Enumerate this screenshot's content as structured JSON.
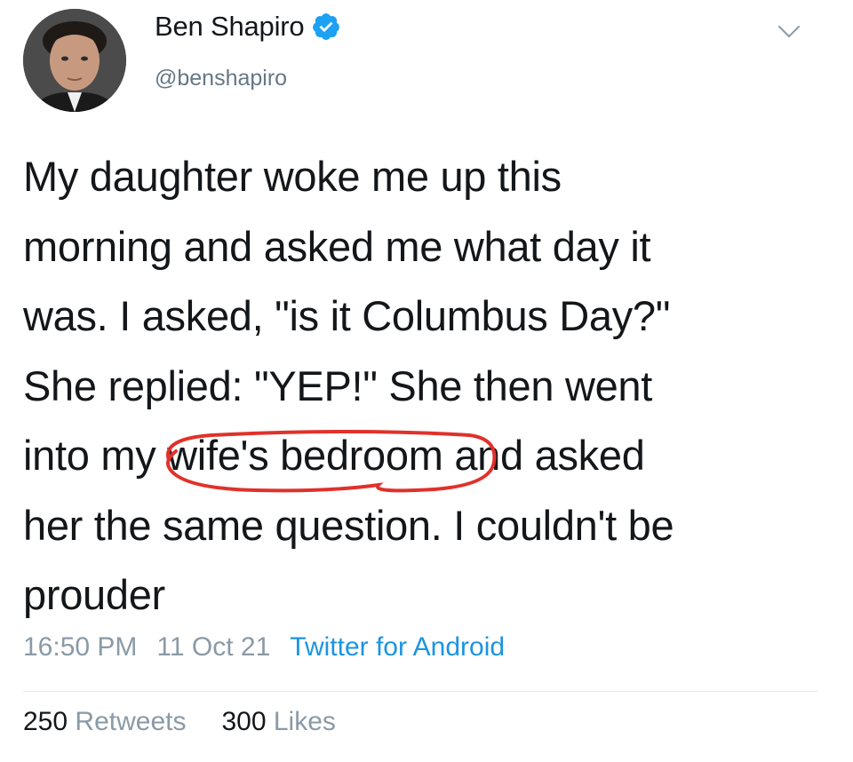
{
  "author": {
    "display_name": "Ben Shapiro",
    "handle": "@benshapiro",
    "verified": true
  },
  "tweet": {
    "lines": [
      "My daughter woke me up this",
      "morning and asked me what day it",
      "was. I asked, \"is it Columbus Day?\"",
      "She replied: \"YEP!\" She then went"
    ],
    "line5_before": "into my ",
    "line5_circled": "wife's bedroom",
    "line5_after": " and asked",
    "line6": "her the same question. I couldn't be",
    "line7": "prouder"
  },
  "meta": {
    "time": "16:50 PM",
    "date": "11 Oct 21",
    "source": "Twitter for Android"
  },
  "stats": {
    "retweets_count": "250",
    "retweets_label": "Retweets",
    "likes_count": "300",
    "likes_label": "Likes"
  },
  "colors": {
    "text": "#14171a",
    "secondary": "#657786",
    "link": "#1b95e0",
    "verified": "#1da1f2",
    "annotation": "#e0312b"
  },
  "icons": {
    "verified": "verified-badge-icon",
    "menu": "chevron-down-icon"
  }
}
